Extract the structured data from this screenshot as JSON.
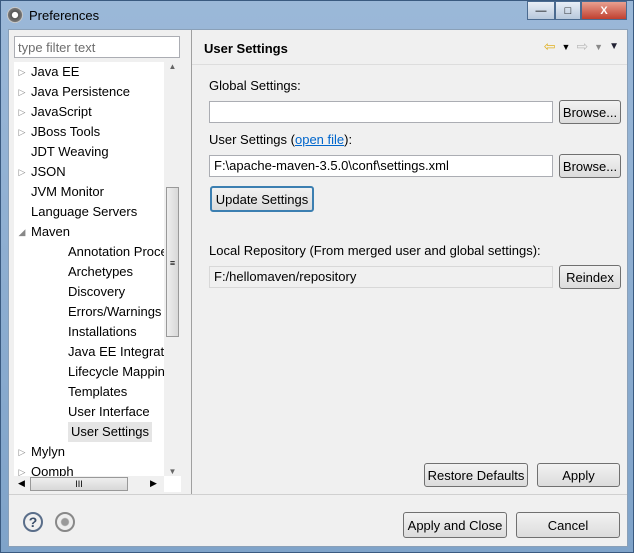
{
  "window": {
    "title": "Preferences",
    "minimize": "—",
    "maximize": "□",
    "close": "X"
  },
  "filter": {
    "placeholder": "type filter text"
  },
  "tree": [
    {
      "label": "Java EE",
      "level": 0,
      "arrow": "▷"
    },
    {
      "label": "Java Persistence",
      "level": 0,
      "arrow": "▷"
    },
    {
      "label": "JavaScript",
      "level": 0,
      "arrow": "▷"
    },
    {
      "label": "JBoss Tools",
      "level": 0,
      "arrow": "▷"
    },
    {
      "label": "JDT Weaving",
      "level": 0,
      "arrow": ""
    },
    {
      "label": "JSON",
      "level": 0,
      "arrow": "▷"
    },
    {
      "label": "JVM Monitor",
      "level": 0,
      "arrow": ""
    },
    {
      "label": "Language Servers",
      "level": 0,
      "arrow": ""
    },
    {
      "label": "Maven",
      "level": 0,
      "arrow": "◢"
    },
    {
      "label": "Annotation Processing",
      "level": 1,
      "arrow": ""
    },
    {
      "label": "Archetypes",
      "level": 1,
      "arrow": ""
    },
    {
      "label": "Discovery",
      "level": 1,
      "arrow": ""
    },
    {
      "label": "Errors/Warnings",
      "level": 1,
      "arrow": ""
    },
    {
      "label": "Installations",
      "level": 1,
      "arrow": ""
    },
    {
      "label": "Java EE Integration",
      "level": 1,
      "arrow": ""
    },
    {
      "label": "Lifecycle Mappings",
      "level": 1,
      "arrow": ""
    },
    {
      "label": "Templates",
      "level": 1,
      "arrow": ""
    },
    {
      "label": "User Interface",
      "level": 1,
      "arrow": ""
    },
    {
      "label": "User Settings",
      "level": 1,
      "arrow": "",
      "selected": true
    },
    {
      "label": "Mylyn",
      "level": 0,
      "arrow": "▷"
    },
    {
      "label": "Oomph",
      "level": 0,
      "arrow": "▷"
    }
  ],
  "page": {
    "title": "User Settings",
    "global_label": "Global Settings:",
    "global_value": "",
    "browse": "Browse...",
    "user_label_pre": "User Settings (",
    "open_file": "open file",
    "user_label_post": "):",
    "user_value": "F:\\apache-maven-3.5.0\\conf\\settings.xml",
    "update": "Update Settings",
    "local_label": "Local Repository (From merged user and global settings):",
    "local_value": "F:/hellomaven/repository",
    "reindex": "Reindex",
    "restore": "Restore Defaults",
    "apply": "Apply"
  },
  "footer": {
    "apply_close": "Apply and Close",
    "cancel": "Cancel",
    "help": "?"
  }
}
